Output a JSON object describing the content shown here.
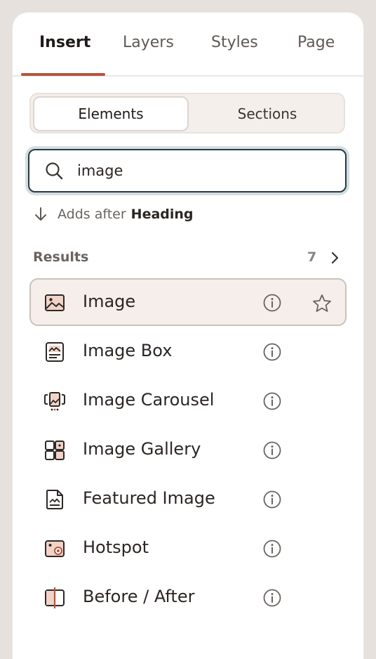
{
  "tabs": [
    {
      "label": "Insert",
      "active": true
    },
    {
      "label": "Layers"
    },
    {
      "label": "Styles"
    },
    {
      "label": "Page"
    }
  ],
  "segment": {
    "elements_label": "Elements",
    "sections_label": "Sections"
  },
  "search": {
    "value": "image",
    "icon": "search-icon"
  },
  "insert_hint": {
    "prefix": "Adds after",
    "target": "Heading"
  },
  "results": {
    "label": "Results",
    "count": "7",
    "items": [
      {
        "label": "Image",
        "icon": "image-icon",
        "selected": true
      },
      {
        "label": "Image Box",
        "icon": "image-box-icon"
      },
      {
        "label": "Image Carousel",
        "icon": "image-carousel-icon"
      },
      {
        "label": "Image Gallery",
        "icon": "image-gallery-icon"
      },
      {
        "label": "Featured Image",
        "icon": "featured-image-icon"
      },
      {
        "label": "Hotspot",
        "icon": "hotspot-icon"
      },
      {
        "label": "Before / After",
        "icon": "before-after-icon"
      }
    ]
  },
  "colors": {
    "accent": "#b8543d",
    "accent_fill": "#f2d3c8",
    "search_border": "#253a44"
  }
}
